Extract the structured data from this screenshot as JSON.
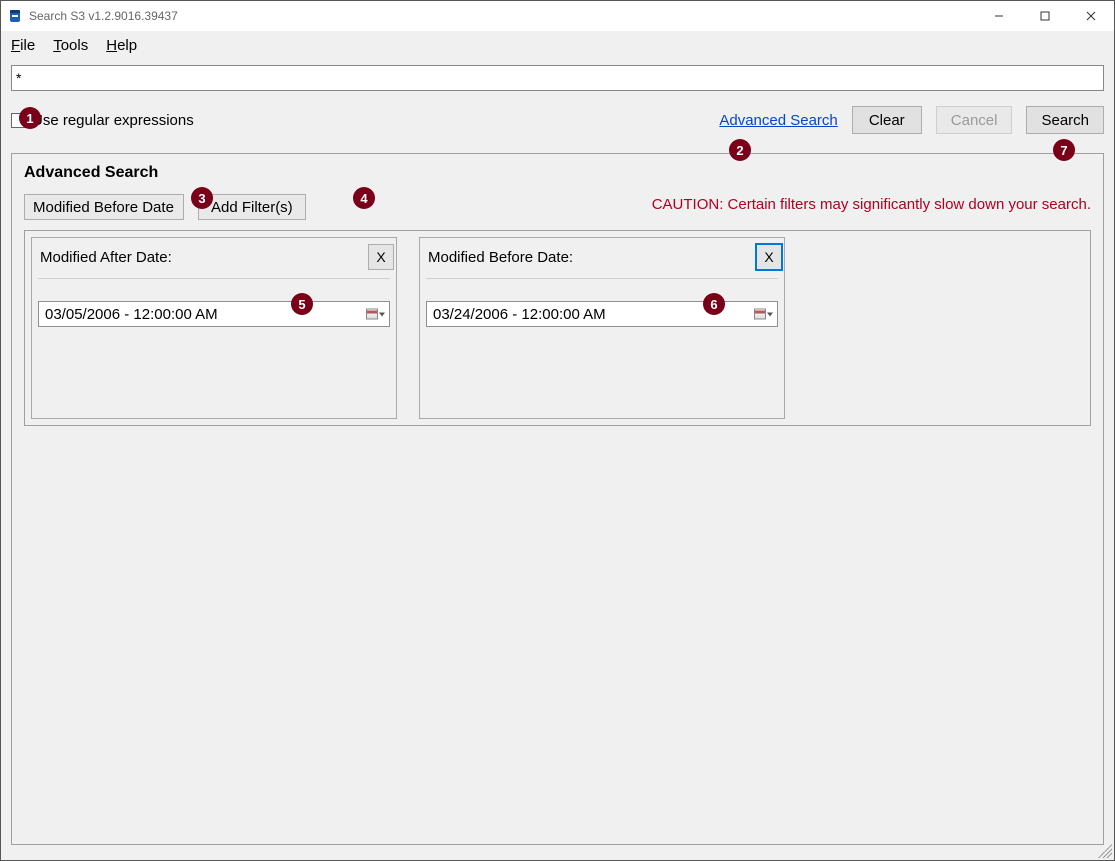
{
  "titlebar": {
    "title": "Search S3 v1.2.9016.39437"
  },
  "menu": {
    "file": "File",
    "tools": "Tools",
    "help": "Help"
  },
  "search_value": "*",
  "regex_label": "Use regular expressions",
  "advanced_link": "Advanced Search",
  "buttons": {
    "clear": "Clear",
    "cancel": "Cancel",
    "search": "Search"
  },
  "adv": {
    "title": "Advanced Search",
    "combo_selected": "Modified Before Date",
    "add_filter": "Add Filter(s)",
    "caution": "CAUTION: Certain filters may significantly slow down your search.",
    "close_x": "X",
    "cards": [
      {
        "label": "Modified After Date:",
        "value": "03/05/2006 - 12:00:00 AM"
      },
      {
        "label": "Modified Before Date:",
        "value": "03/24/2006 - 12:00:00 AM"
      }
    ]
  },
  "badges": [
    "1",
    "2",
    "3",
    "4",
    "5",
    "6",
    "7"
  ]
}
